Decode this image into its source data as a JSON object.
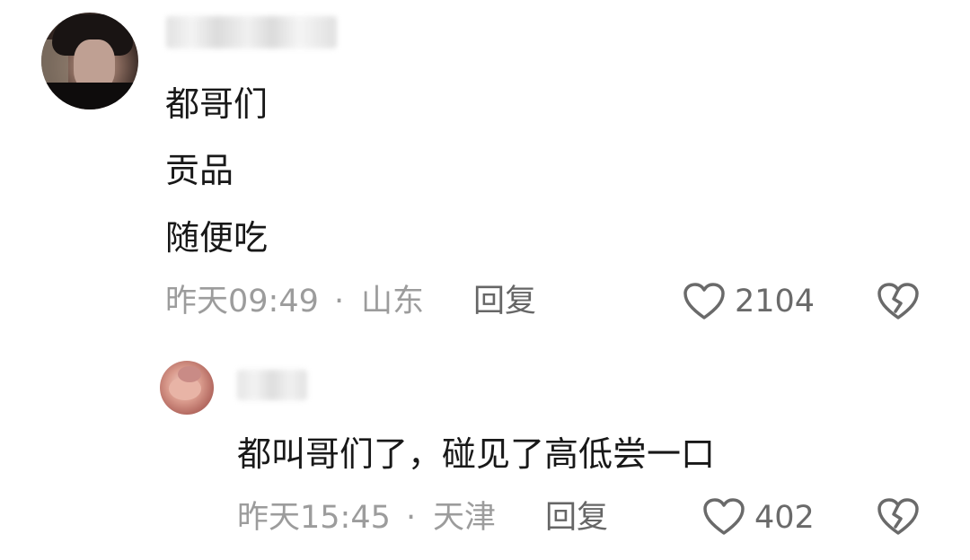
{
  "comment": {
    "lines": [
      "都哥们",
      "贡品",
      "随便吃"
    ],
    "time": "昨天09:49",
    "separator": "·",
    "location": "山东",
    "reply_label": "回复",
    "like_count": "2104",
    "icons": {
      "like": "heart-outline-icon",
      "dislike": "broken-heart-icon"
    }
  },
  "reply": {
    "text": "都叫哥们了，碰见了高低尝一口",
    "time": "昨天15:45",
    "separator": "·",
    "location": "天津",
    "reply_label": "回复",
    "like_count": "402",
    "icons": {
      "like": "heart-outline-icon",
      "dislike": "broken-heart-icon"
    }
  },
  "colors": {
    "text": "#181818",
    "meta": "#9c9c9c",
    "icon": "#6a6a6a",
    "background": "#ffffff"
  }
}
